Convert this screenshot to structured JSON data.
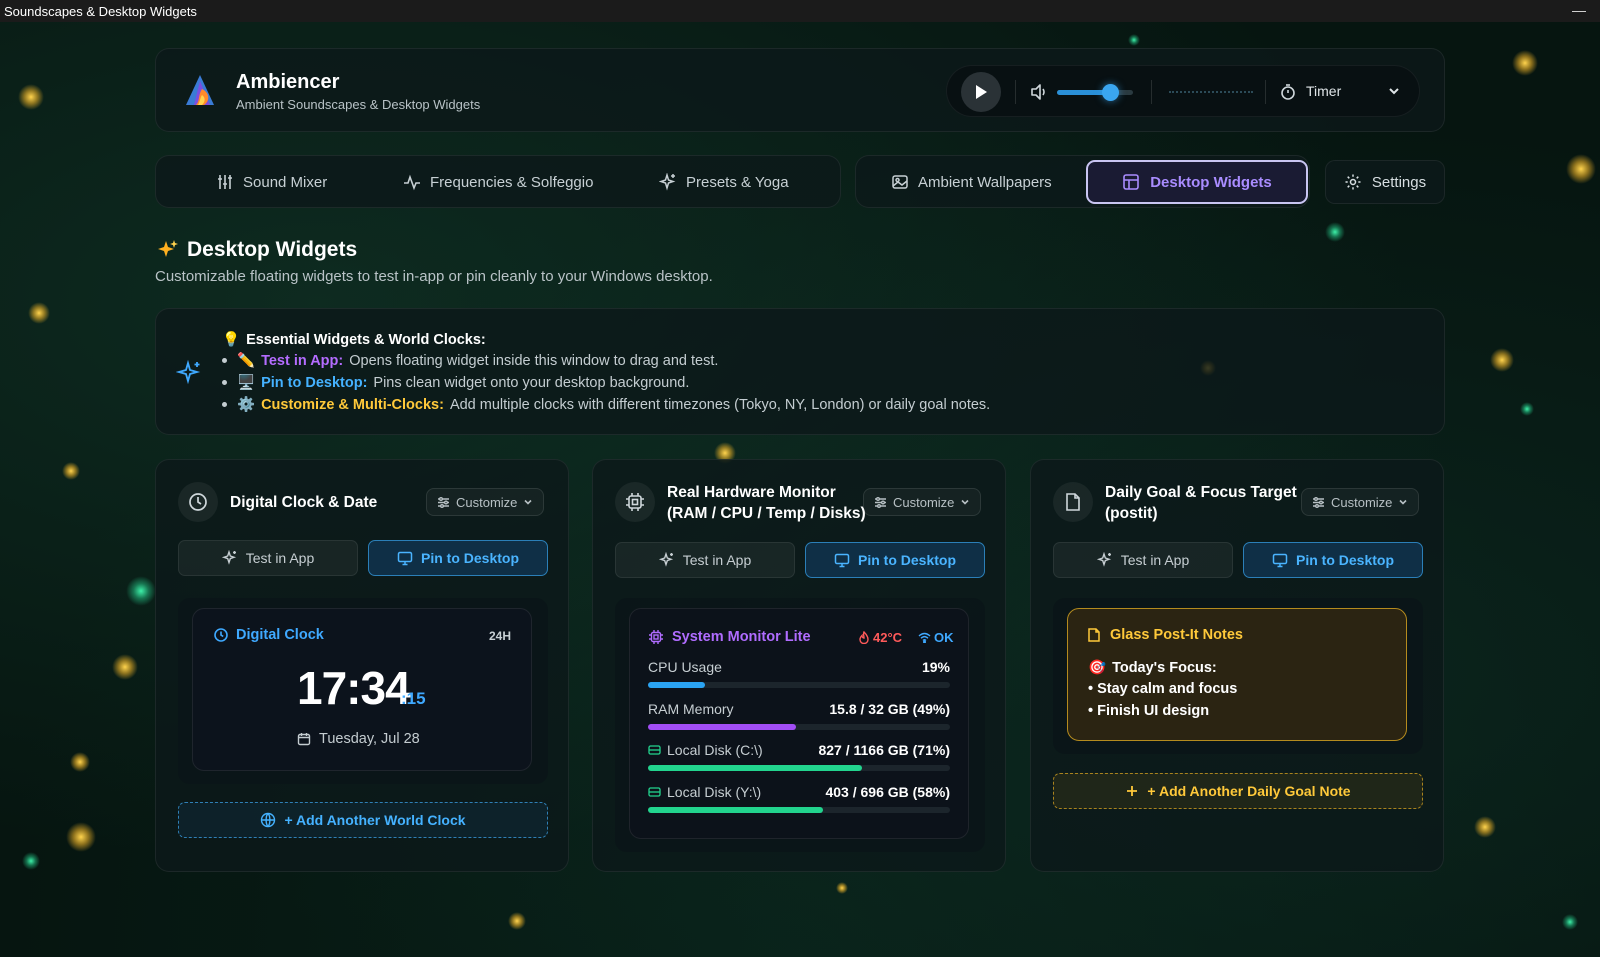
{
  "window": {
    "title": "Soundscapes & Desktop Widgets",
    "minimize": "—"
  },
  "app": {
    "name": "Ambiencer",
    "subtitle": "Ambient Soundscapes & Desktop Widgets"
  },
  "player": {
    "volume": 0.7,
    "timer_label": "Timer"
  },
  "tabs": {
    "group1": [
      {
        "label": "Sound Mixer",
        "icon": "sliders-icon"
      },
      {
        "label": "Frequencies & Solfeggio",
        "icon": "pulse-icon"
      },
      {
        "label": "Presets & Yoga",
        "icon": "sparkles-icon"
      }
    ],
    "group2": [
      {
        "label": "Ambient Wallpapers",
        "icon": "image-icon"
      },
      {
        "label": "Desktop Widgets",
        "icon": "layout-icon",
        "active": true
      }
    ],
    "settings": "Settings"
  },
  "section": {
    "title": "Desktop Widgets",
    "subtitle": "Customizable floating widgets to test in-app or pin cleanly to your Windows desktop."
  },
  "info": {
    "title": "Essential Widgets & World Clocks:",
    "items": [
      {
        "key": "Test in App:",
        "text": "Opens floating widget inside this window to drag and test."
      },
      {
        "key": "Pin to Desktop:",
        "text": "Pins clean widget onto your desktop background."
      },
      {
        "key": "Customize & Multi-Clocks:",
        "text": "Add multiple clocks with different timezones (Tokyo, NY, London) or daily goal notes."
      }
    ]
  },
  "buttons": {
    "customize": "Customize",
    "test": "Test in App",
    "pin": "Pin to Desktop"
  },
  "widgets": {
    "clock": {
      "title": "Digital Clock & Date",
      "preview_label": "Digital Clock",
      "format": "24H",
      "time": "17:34",
      "seconds": ":15",
      "date": "Tuesday, Jul 28",
      "add_label": "+ Add Another World Clock"
    },
    "monitor": {
      "title_line1": "Real Hardware Monitor",
      "title_line2": "(RAM / CPU / Temp / Disks)",
      "preview_label": "System Monitor Lite",
      "temp": "42°C",
      "status": "OK",
      "rows": [
        {
          "label": "CPU Usage",
          "value": "19%",
          "fraction": 0.19,
          "color": "#2aa3f2"
        },
        {
          "label": "RAM Memory",
          "value": "15.8 / 32 GB (49%)",
          "fraction": 0.49,
          "color": "#a24df5"
        },
        {
          "label": "Local Disk (C:\\)",
          "value": "827 / 1166 GB (71%)",
          "fraction": 0.71,
          "color": "#22d48e"
        },
        {
          "label": "Local Disk (Y:\\)",
          "value": "403 / 696 GB (58%)",
          "fraction": 0.58,
          "color": "#22d48e"
        }
      ]
    },
    "goal": {
      "title_line1": "Daily Goal & Focus Target",
      "title_line2": "(postit)",
      "preview_label": "Glass Post-It Notes",
      "lines": [
        "Today's Focus:",
        "• Stay calm and focus",
        "• Finish UI design"
      ],
      "add_label": "+ Add Another Daily Goal Note"
    }
  },
  "colors": {
    "accent_purple": "#a98cff",
    "accent_blue": "#4ab4ff",
    "accent_gold": "#ffc93a"
  }
}
